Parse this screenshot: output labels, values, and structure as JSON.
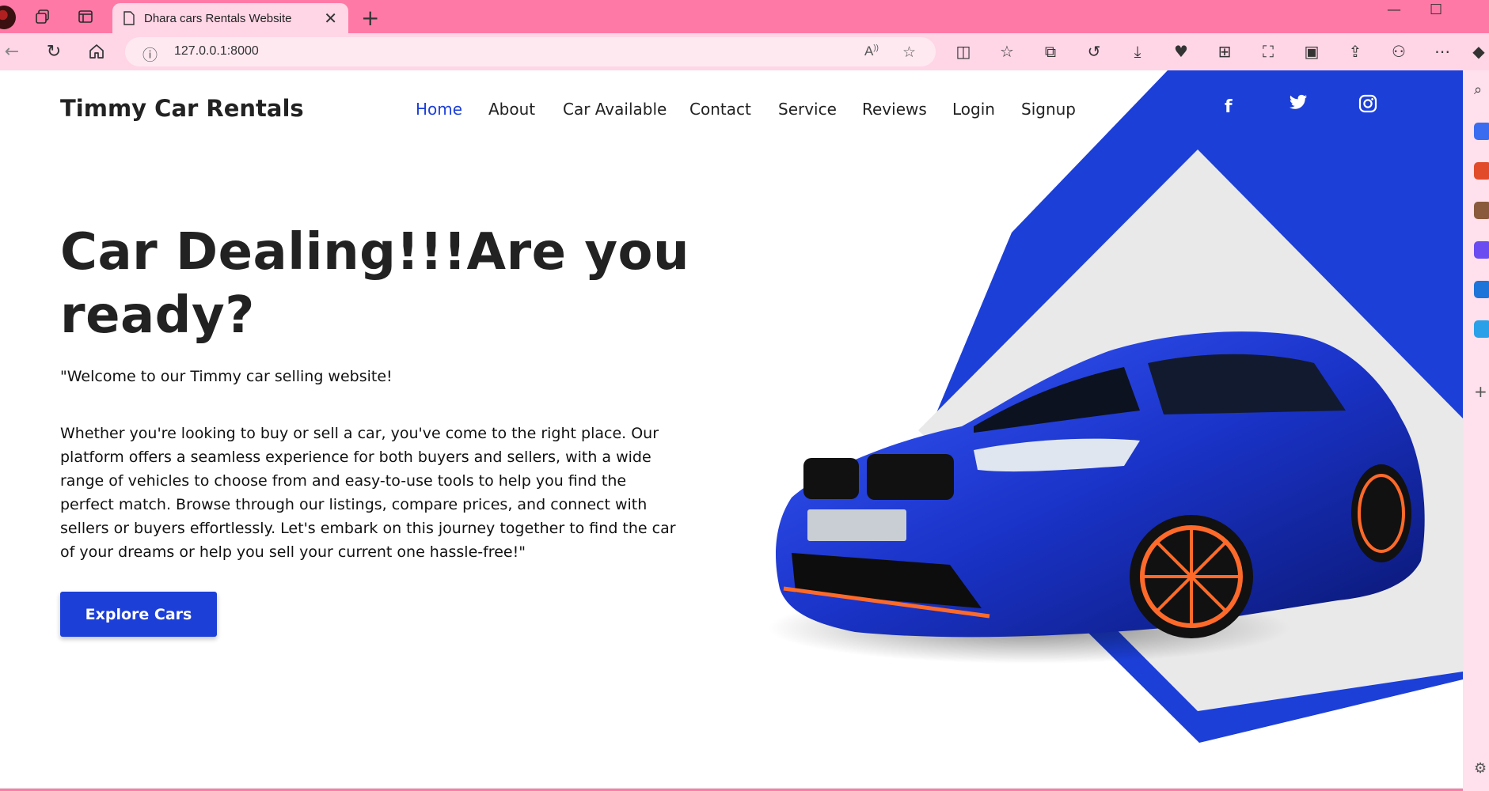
{
  "browser": {
    "tab_title": "Dhara cars Rentals Website",
    "url": "127.0.0.1:8000"
  },
  "site": {
    "brand": "Timmy Car Rentals",
    "nav": [
      "Home",
      "About",
      "Car Available",
      "Contact",
      "Service",
      "Reviews",
      "Login",
      "Signup"
    ],
    "active_nav": "Home",
    "social": [
      "facebook-icon",
      "twitter-icon",
      "instagram-icon"
    ]
  },
  "hero": {
    "title": "Car Dealing!!!Are you ready?",
    "welcome": "\"Welcome to our Timmy car selling website!",
    "paragraph": "Whether you're looking to buy or sell a car, you've come to the right place. Our platform offers a seamless experience for both buyers and sellers, with a wide range of vehicles to choose from and easy-to-use tools to help you find the perfect match. Browse through our listings, compare prices, and connect with sellers or buyers effortlessly. Let's embark on this journey together to find the car of your dreams or help you sell your current one hassle-free!\"",
    "cta_label": "Explore Cars"
  },
  "colors": {
    "accent": "#1c3fd8",
    "browser_frame": "#ff79a6",
    "browser_toolbar": "#ffd6e6",
    "car_body": "#1a33c8",
    "diamond_fill": "#e8e8e8"
  }
}
